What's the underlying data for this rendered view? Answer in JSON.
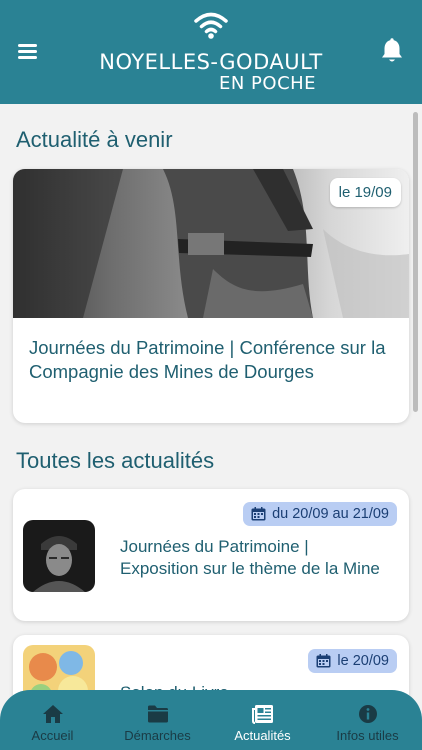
{
  "header": {
    "logo_line1": "NOYELLES-GODAULT",
    "logo_line2": "EN POCHE",
    "menu_icon": "hamburger-icon",
    "bell_icon": "bell-icon"
  },
  "upcoming": {
    "title": "Actualité à venir",
    "item": {
      "date": "le 19/09",
      "title": "Journées du Patrimoine | Conférence sur la Compagnie des Mines de Dourges"
    }
  },
  "all_news": {
    "title": "Toutes les actualités",
    "items": [
      {
        "date": "du 20/09 au 21/09",
        "title": "Journées du Patrimoine | Exposition sur le thème de la Mine"
      },
      {
        "date": "le 20/09",
        "title": "Salon du Livre"
      }
    ]
  },
  "tabbar": {
    "tabs": [
      {
        "label": "Accueil",
        "icon": "home-icon"
      },
      {
        "label": "Démarches",
        "icon": "folder-icon"
      },
      {
        "label": "Actualités",
        "icon": "newspaper-icon"
      },
      {
        "label": "Infos utiles",
        "icon": "info-icon"
      }
    ],
    "active": "Actualités"
  },
  "colors": {
    "header_bg": "#2a8294",
    "title_text": "#1f5f70",
    "badge_blue": "#b9cdf3"
  }
}
